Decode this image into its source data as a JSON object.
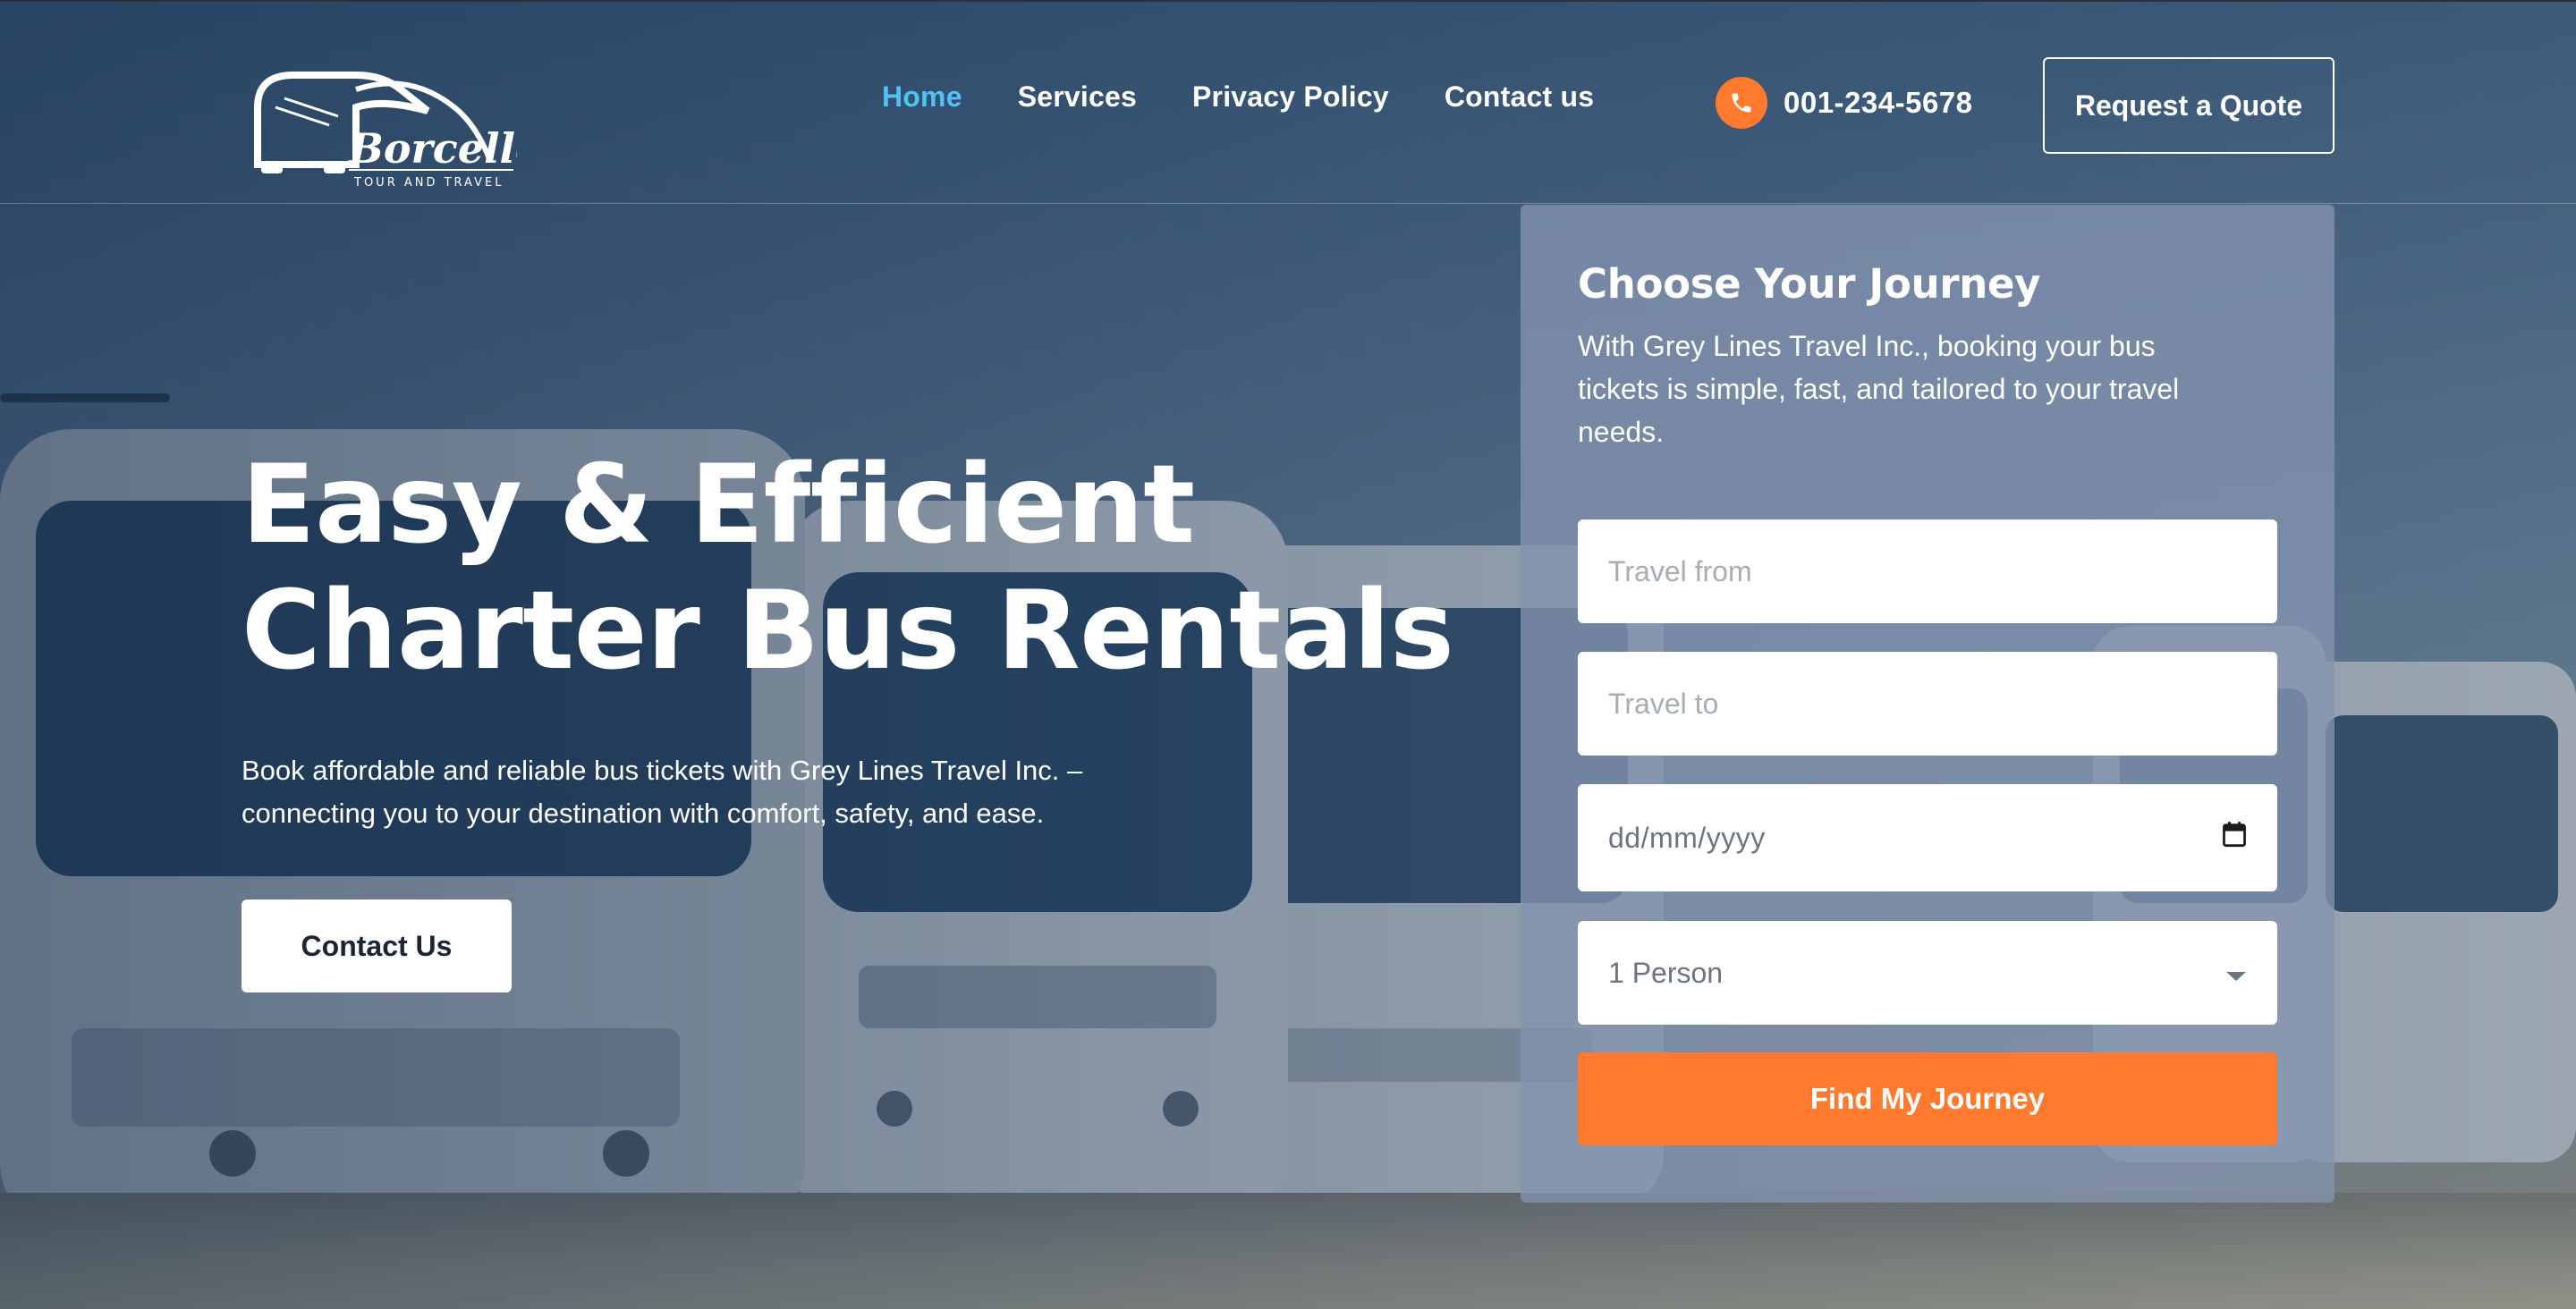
{
  "brand": {
    "name": "Borcelle",
    "tagline": "TOUR AND TRAVEL"
  },
  "nav": {
    "items": [
      {
        "label": "Home",
        "active": true
      },
      {
        "label": "Services",
        "active": false
      },
      {
        "label": "Privacy Policy",
        "active": false
      },
      {
        "label": "Contact us",
        "active": false
      }
    ]
  },
  "header": {
    "phone": "001-234-5678",
    "phone_icon": "phone-icon",
    "quote_button": "Request a Quote"
  },
  "hero": {
    "title_line1": "Easy & Efficient",
    "title_line2": "Charter Bus Rentals",
    "description_line1": "Book affordable and reliable bus tickets with Grey Lines Travel Inc. –",
    "description_line2": "connecting you to your destination with comfort, safety, and ease.",
    "cta_button": "Contact Us"
  },
  "booking": {
    "title": "Choose Your Journey",
    "description_line1": "With Grey Lines Travel Inc., booking your bus",
    "description_line2": "tickets is simple, fast, and tailored to your travel",
    "description_line3": "needs.",
    "from_placeholder": "Travel from",
    "to_placeholder": "Travel to",
    "date_placeholder": "dd/mm/yyyy",
    "date_icon": "calendar-icon",
    "persons_selected": "1 Person",
    "persons_icon": "caret-down-icon",
    "submit_button": "Find My Journey"
  },
  "colors": {
    "accent": "#ff7a2e",
    "nav_active": "#4fc3f7",
    "card_bg": "#8494b0"
  }
}
